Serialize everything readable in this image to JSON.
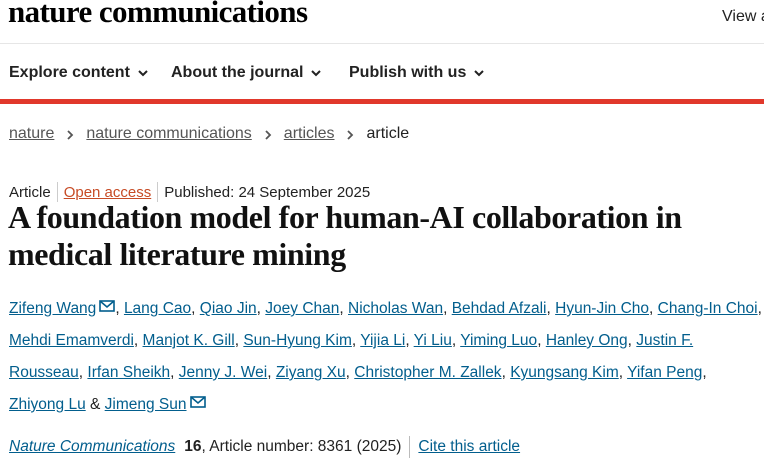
{
  "header": {
    "logo": "nature communications",
    "view_link": "View a"
  },
  "nav": [
    {
      "label": "Explore content"
    },
    {
      "label": "About the journal"
    },
    {
      "label": "Publish with us"
    }
  ],
  "breadcrumb": {
    "items": [
      "nature",
      "nature communications",
      "articles"
    ],
    "current": "article"
  },
  "article": {
    "type": "Article",
    "access": "Open access",
    "published": "Published: 24 September 2025",
    "title": "A foundation model for human-AI collaboration in medical literature mining"
  },
  "authors": [
    "Zifeng Wang",
    "Lang Cao",
    "Qiao Jin",
    "Joey Chan",
    "Nicholas Wan",
    "Behdad Afzali",
    "Hyun-Jin Cho",
    "Chang-In Choi",
    "Mehdi Emamverdi",
    "Manjot K. Gill",
    "Sun-Hyung Kim",
    "Yijia Li",
    "Yi Liu",
    "Yiming Luo",
    "Hanley Ong",
    "Justin F. Rousseau",
    "Irfan Sheikh",
    "Jenny J. Wei",
    "Ziyang Xu",
    "Christopher M. Zallek",
    "Kyungsang Kim",
    "Yifan Peng",
    "Zhiyong Lu",
    "Jimeng Sun"
  ],
  "authors_text": {
    "separator": ", ",
    "and": " & "
  },
  "citation": {
    "journal": "Nature Communications",
    "volume": "16",
    "details": ", Article number: 8361 (2025)",
    "cite_link": "Cite this article"
  },
  "colors": {
    "accent_red": "#e1382b",
    "link_blue": "#025e8d",
    "open_access": "#c74b25"
  }
}
